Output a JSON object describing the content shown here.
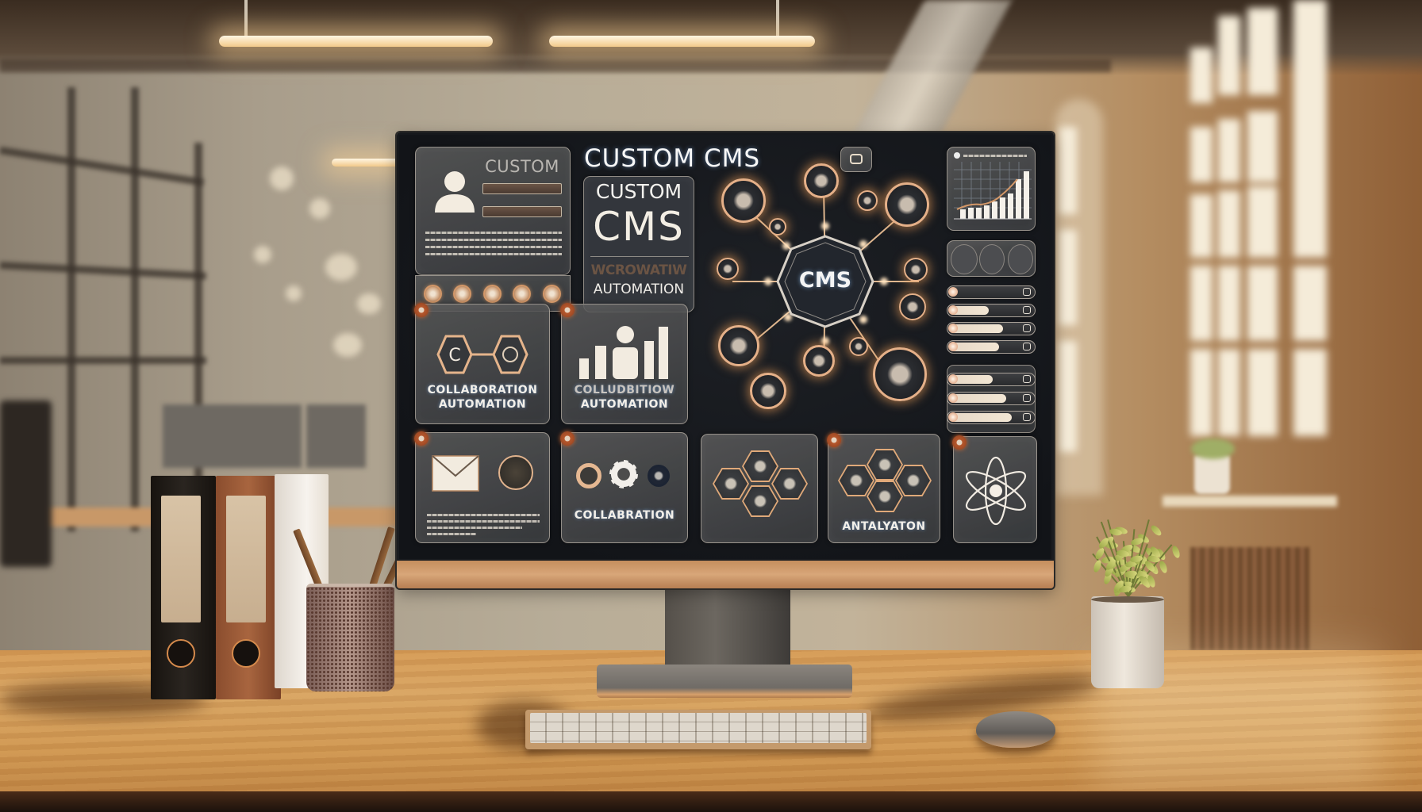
{
  "screen": {
    "title": "CUSTOM CMS",
    "profile_panel": {
      "heading": "CUSTOM",
      "action_icons": [
        "link-icon",
        "chat-icon",
        "drop-icon",
        "leaf-icon",
        "eye-icon"
      ]
    },
    "brand_panel": {
      "line1": "CUSTOM",
      "line2": "CMS",
      "garbled_line": "WCROWATIW",
      "line3": "AUTOMATION"
    },
    "hub": {
      "center_label": "CMS"
    },
    "tiles": [
      {
        "id": "collab-automation",
        "title_line1": "COLLABORATION",
        "title_line2": "AUTOMATION",
        "icon": "hexagon-link-icon"
      },
      {
        "id": "analytics-automation",
        "title_line1": "COLLUDBITIOW",
        "title_line2": "AUTOMATION",
        "icon": "user-bars-icon"
      },
      {
        "id": "mail",
        "title_line1": "",
        "icon": "envelope-icon"
      },
      {
        "id": "collaboration",
        "title_line1": "COLLABRATION",
        "icon": "gear-icon"
      },
      {
        "id": "modules",
        "title_line1": "",
        "icon": "honeycomb-icon"
      },
      {
        "id": "installation",
        "title_line1": "ANTALYATON",
        "icon": "honeycomb-icon"
      },
      {
        "id": "integration",
        "title_line1": "",
        "icon": "atom-icon"
      }
    ],
    "sidebar": {
      "chart_icon": "bar-chart-icon",
      "quick_icons": [
        "spiral-icon",
        "hook-icon",
        "puzzle-icon"
      ],
      "sliders_group1": [
        0.05,
        0.45,
        0.62,
        0.57
      ],
      "sliders_group2": [
        0.5,
        0.65,
        0.72
      ]
    }
  },
  "colors": {
    "screen_bg": "#121418",
    "accent_copper": "#d58a4c",
    "panel_border": "#dcd2c3",
    "text": "#f2efe9"
  }
}
